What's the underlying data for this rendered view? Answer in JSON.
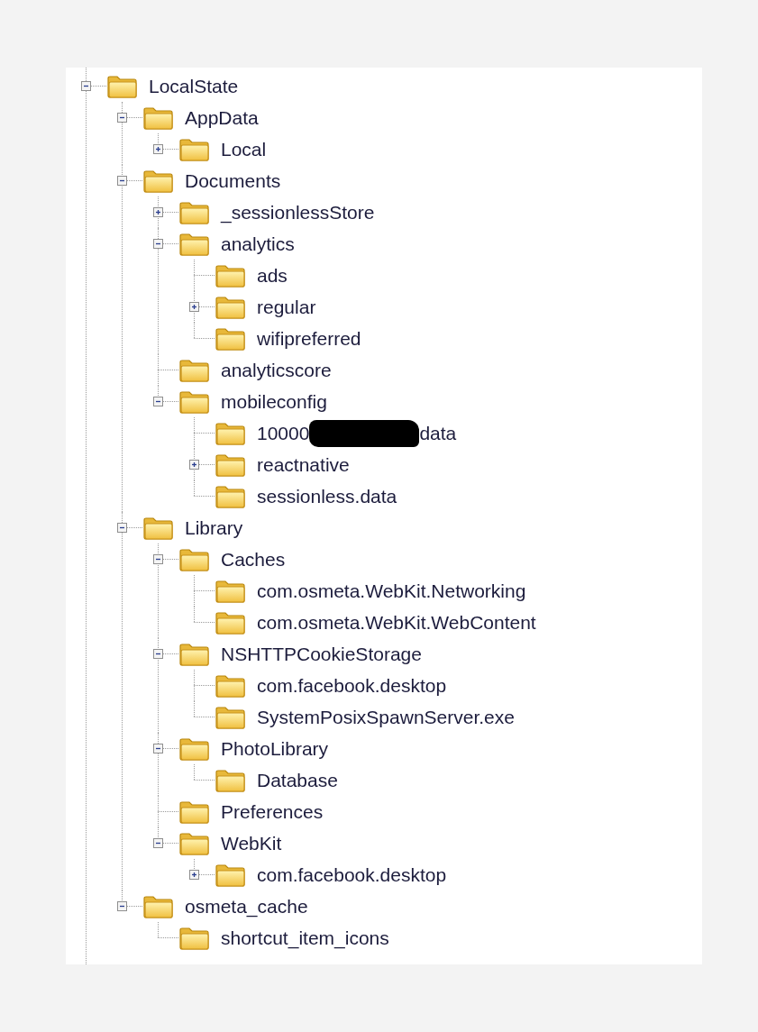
{
  "tree": [
    {
      "label": "LocalState",
      "kind": "branch",
      "expanded": true,
      "children": [
        {
          "label": "AppData",
          "kind": "branch",
          "expanded": true,
          "children": [
            {
              "label": "Local",
              "kind": "branch",
              "expanded": false
            }
          ]
        },
        {
          "label": "Documents",
          "kind": "branch",
          "expanded": true,
          "children": [
            {
              "label": "_sessionlessStore",
              "kind": "branch",
              "expanded": false
            },
            {
              "label": "analytics",
              "kind": "branch",
              "expanded": true,
              "children": [
                {
                  "label": "ads",
                  "kind": "leaf"
                },
                {
                  "label": "regular",
                  "kind": "branch",
                  "expanded": false
                },
                {
                  "label": "wifipreferred",
                  "kind": "leaf"
                }
              ]
            },
            {
              "label": "analyticscore",
              "kind": "leaf"
            },
            {
              "label": "mobileconfig",
              "kind": "branch",
              "expanded": true,
              "children": [
                {
                  "label": "10000",
                  "redacted": true,
                  "label_after": "data",
                  "kind": "leaf"
                },
                {
                  "label": "reactnative",
                  "kind": "branch",
                  "expanded": false
                },
                {
                  "label": "sessionless.data",
                  "kind": "leaf"
                }
              ]
            }
          ]
        },
        {
          "label": "Library",
          "kind": "branch",
          "expanded": true,
          "children": [
            {
              "label": "Caches",
              "kind": "branch",
              "expanded": true,
              "children": [
                {
                  "label": "com.osmeta.WebKit.Networking",
                  "kind": "leaf"
                },
                {
                  "label": "com.osmeta.WebKit.WebContent",
                  "kind": "leaf"
                }
              ]
            },
            {
              "label": "NSHTTPCookieStorage",
              "kind": "branch",
              "expanded": true,
              "children": [
                {
                  "label": "com.facebook.desktop",
                  "kind": "leaf"
                },
                {
                  "label": "SystemPosixSpawnServer.exe",
                  "kind": "leaf"
                }
              ]
            },
            {
              "label": "PhotoLibrary",
              "kind": "branch",
              "expanded": true,
              "children": [
                {
                  "label": "Database",
                  "kind": "leaf"
                }
              ]
            },
            {
              "label": "Preferences",
              "kind": "leaf"
            },
            {
              "label": "WebKit",
              "kind": "branch",
              "expanded": true,
              "children": [
                {
                  "label": "com.facebook.desktop",
                  "kind": "branch",
                  "expanded": false
                }
              ]
            }
          ]
        },
        {
          "label": "osmeta_cache",
          "kind": "branch",
          "expanded": true,
          "children": [
            {
              "label": "shortcut_item_icons",
              "kind": "leaf"
            }
          ]
        }
      ]
    }
  ]
}
